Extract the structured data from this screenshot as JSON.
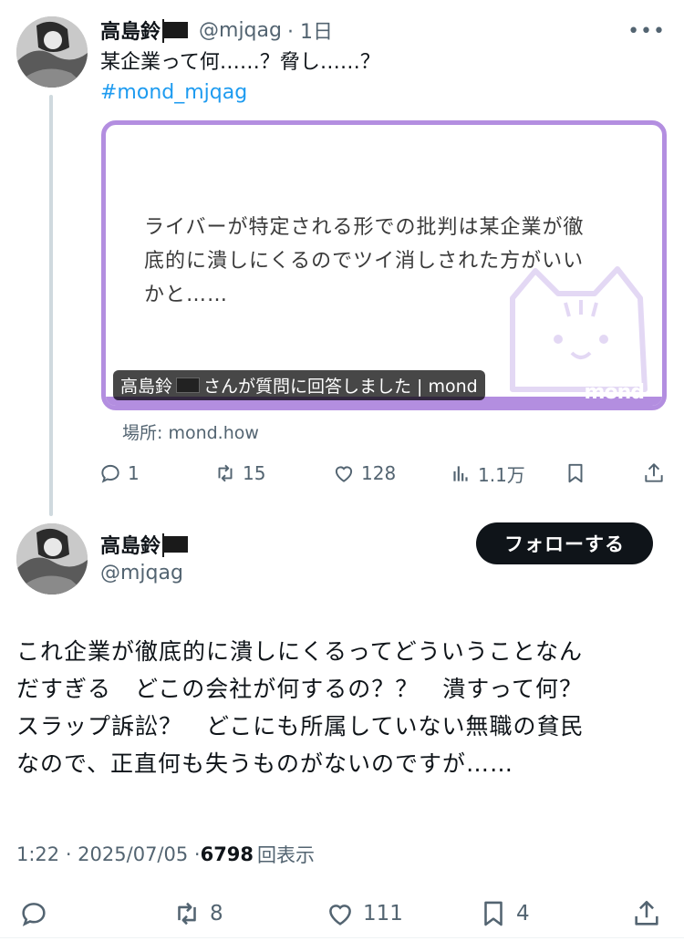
{
  "tweet1": {
    "name": "高島鈴",
    "handle": "@mjqag",
    "time": "· 1日",
    "more_label": "•••",
    "text": "某企業って何……？脅し……？",
    "hashtag": "#mond_mjqag",
    "card": {
      "lines": [
        "ライバーが特定される形での批判は某企業が徹",
        "底的に潰しにくるのでツイ消しされた方がいい",
        "かと……"
      ],
      "caption_name": "高島鈴",
      "caption_rest": "さんが質問に回答しました | mond",
      "brand": "mond"
    },
    "location": "場所: mond.how",
    "actions": {
      "replies": "1",
      "retweets": "15",
      "likes": "128",
      "views": "1.1万"
    }
  },
  "tweet2": {
    "name": "高島鈴",
    "handle": "@mjqag",
    "follow_label": "フォローする",
    "body_lines": [
      "これ企業が徹底的に潰しにくるってどういうことなん",
      "だすぎる　どこの会社が何するの？？　潰すって何？",
      "スラップ訴訟？　どこにも所属していない無職の貧民",
      "なので、正直何も失うものがないのですが……"
    ],
    "time": "1:22 · 2025/07/05 · ",
    "views_count": "6798",
    "views_label": "回表示",
    "actions": {
      "retweets": "8",
      "likes": "111",
      "bookmarks": "4"
    }
  },
  "colors": {
    "accent": "#1d9bf0",
    "card_border": "#b38ee0",
    "muted": "#536471"
  }
}
